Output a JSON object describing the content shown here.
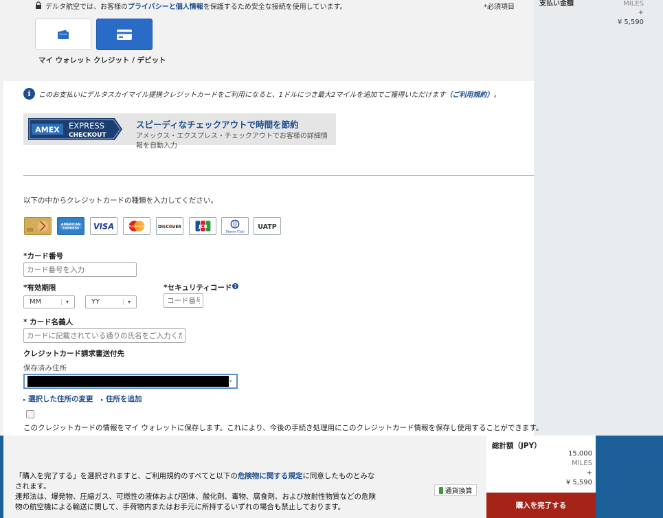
{
  "summary": {
    "payment_label": "支払い金額",
    "miles_unit": "MILES",
    "plus": "+",
    "yen": "¥ 5,590"
  },
  "header": {
    "secure_prefix": "デルタ航空では、お客様の",
    "secure_link": "プライバシーと個人情報",
    "secure_suffix": "を保護するため安全な接続を使用しています。",
    "required_note": "*必須項目"
  },
  "tabs": [
    {
      "label": "マイ ウォレット"
    },
    {
      "label": "クレジット / デビット"
    }
  ],
  "info": {
    "text": "このお支払いにデルタスカイマイル提携クレジットカードをご利用になると、1ドルにつき最大2マイルを追加でご獲得いただけます",
    "link": "（ご利用規約）",
    "end": "。"
  },
  "amex": {
    "logo_text": "AMEX",
    "express": "EXPRESS",
    "checkout": "CHECKOUT",
    "title": "スピーディなチェックアウトで時間を節約",
    "desc": "アメックス・エクスプレス・チェックアウトでお客様の詳細情報を自動入力"
  },
  "card_type_label": "以下の中からクレジットカードの種類を入力してください。",
  "cards": [
    {
      "name": "delta-skymiles-gold",
      "label": ""
    },
    {
      "name": "american-express",
      "label": "AMERICAN EXPRESS"
    },
    {
      "name": "visa",
      "label": "VISA"
    },
    {
      "name": "mastercard",
      "label": "MasterCard"
    },
    {
      "name": "discover",
      "label": "DISCOVER"
    },
    {
      "name": "jcb",
      "label": "JCB"
    },
    {
      "name": "diners-club",
      "label": "Diners Club"
    },
    {
      "name": "uatp",
      "label": "UATP"
    }
  ],
  "form": {
    "card_number_label": "*カード番号",
    "card_number_placeholder": "カード番号を入力",
    "expiry_label": "*有効期限",
    "month_value": "MM",
    "year_value": "YY",
    "cvv_label": "*セキュリティコード",
    "cvv_placeholder": "コード番号",
    "name_label": "* カード名義人",
    "name_placeholder": "カードに記載されている通りの氏名をご入力ください",
    "billing_label": "クレジットカード請求書送付先",
    "saved_address_label": "保存済み住所",
    "change_address": "選択した住所の変更",
    "add_address": "住所を追加",
    "save_card_text": "このクレジットカードの情報をマイ ウォレットに保存します。これにより、今後の手続き処理用にこのクレジットカード情報を保存し使用することができます。"
  },
  "footer": {
    "terms_prefix": "「購入を完了する」を選択されますと、ご利用規約のすべてと以下の",
    "terms_link": "危険物に関する規定",
    "terms_suffix": "に同意したものとみなされます。",
    "hazmat": "連邦法は、爆発物、圧縮ガス、可燃性の液体および固体、酸化剤、毒物、腐食剤、および放射性物質などの危険物の航空機による輸送に関して、手荷物内またはお手元に所持するいずれの場合も禁止しております。",
    "currency_button": "通貨換算",
    "total_label": "総計額（JPY）",
    "total_miles": "15,000",
    "miles_unit": "MILES",
    "plus": "+",
    "total_yen": "¥ 5,590",
    "complete_button": "購入を完了する"
  }
}
